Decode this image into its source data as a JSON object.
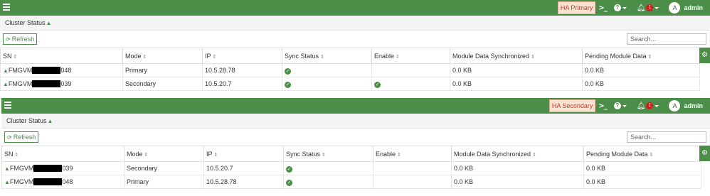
{
  "user": {
    "avatar_letter": "A",
    "name": "admin"
  },
  "notifications": {
    "count": "1"
  },
  "panels": [
    {
      "ha_badge": "HA Primary",
      "subhead": "Cluster Status",
      "refresh_label": "Refresh",
      "search_placeholder": "Search...",
      "columns": [
        "SN",
        "Mode",
        "IP",
        "Sync Status",
        "Enable",
        "Module Data Synchronized",
        "Pending Module Data"
      ],
      "rows": [
        {
          "sn_prefix": "FMGVM",
          "sn_suffix": "048",
          "mode": "Primary",
          "ip": "10.5.28.78",
          "sync": true,
          "enable": false,
          "synced": "0.0 KB",
          "pending": "0.0 KB"
        },
        {
          "sn_prefix": "FMGVM",
          "sn_suffix": "039",
          "mode": "Secondary",
          "ip": "10.5.20.7",
          "sync": true,
          "enable": true,
          "synced": "0.0 KB",
          "pending": "0.0 KB"
        }
      ]
    },
    {
      "ha_badge": "HA Secondary",
      "subhead": "Cluster Status",
      "refresh_label": "Refresh",
      "search_placeholder": "Search...",
      "columns": [
        "SN",
        "Mode",
        "IP",
        "Sync Status",
        "Enable",
        "Module Data Synchronized",
        "Pending Module Data"
      ],
      "rows": [
        {
          "sn_prefix": "FMGVM",
          "sn_suffix": "039",
          "mode": "Secondary",
          "ip": "10.5.20.7",
          "sync": true,
          "enable": false,
          "synced": "0.0 KB",
          "pending": "0.0 KB"
        },
        {
          "sn_prefix": "FMGVM",
          "sn_suffix": "048",
          "mode": "Primary",
          "ip": "10.5.28.78",
          "sync": true,
          "enable": false,
          "synced": "0.0 KB",
          "pending": "0.0 KB"
        }
      ]
    }
  ],
  "colors": {
    "brand_green": "#4a8e47",
    "badge_bg": "#fbe3d2",
    "badge_text": "#c0392b",
    "notif_red": "#d11f1f"
  },
  "icons": {
    "menu": "hamburger-icon",
    "cli": "terminal-icon",
    "help": "help-icon",
    "bell": "bell-icon",
    "refresh": "refresh-icon",
    "sort": "sort-icon",
    "gear": "gear-icon",
    "check": "check-circle-icon",
    "up": "arrow-up-icon"
  }
}
